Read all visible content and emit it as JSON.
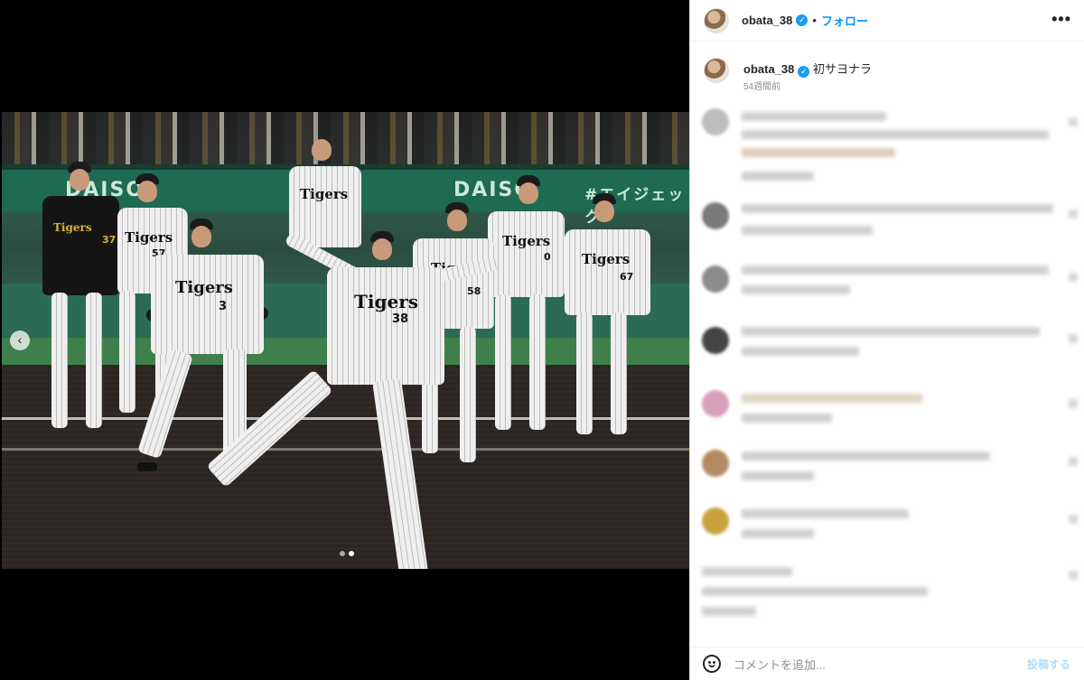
{
  "post": {
    "username": "obata_38",
    "verified_icon": "verified-badge-icon",
    "separator": "•",
    "follow_label": "フォロー",
    "more_icon": "more-options-icon",
    "more_label": "•••"
  },
  "caption": {
    "username": "obata_38",
    "text": "初サヨナラ",
    "time": "54週間前"
  },
  "media": {
    "banner_left": "DAISO",
    "banner_mid": "DAISO",
    "banner_right": "#エイジェック",
    "jersey_text": "Tigers",
    "numbers": [
      "38",
      "3",
      "0",
      "57",
      "37",
      "58",
      "67"
    ],
    "carousel": {
      "current": 2,
      "total": 2
    },
    "prev_icon": "chevron-left-icon",
    "prev_label": "‹"
  },
  "footer": {
    "emoji_icon": "emoji-icon",
    "comment_placeholder": "コメントを追加...",
    "post_label": "投稿する"
  }
}
